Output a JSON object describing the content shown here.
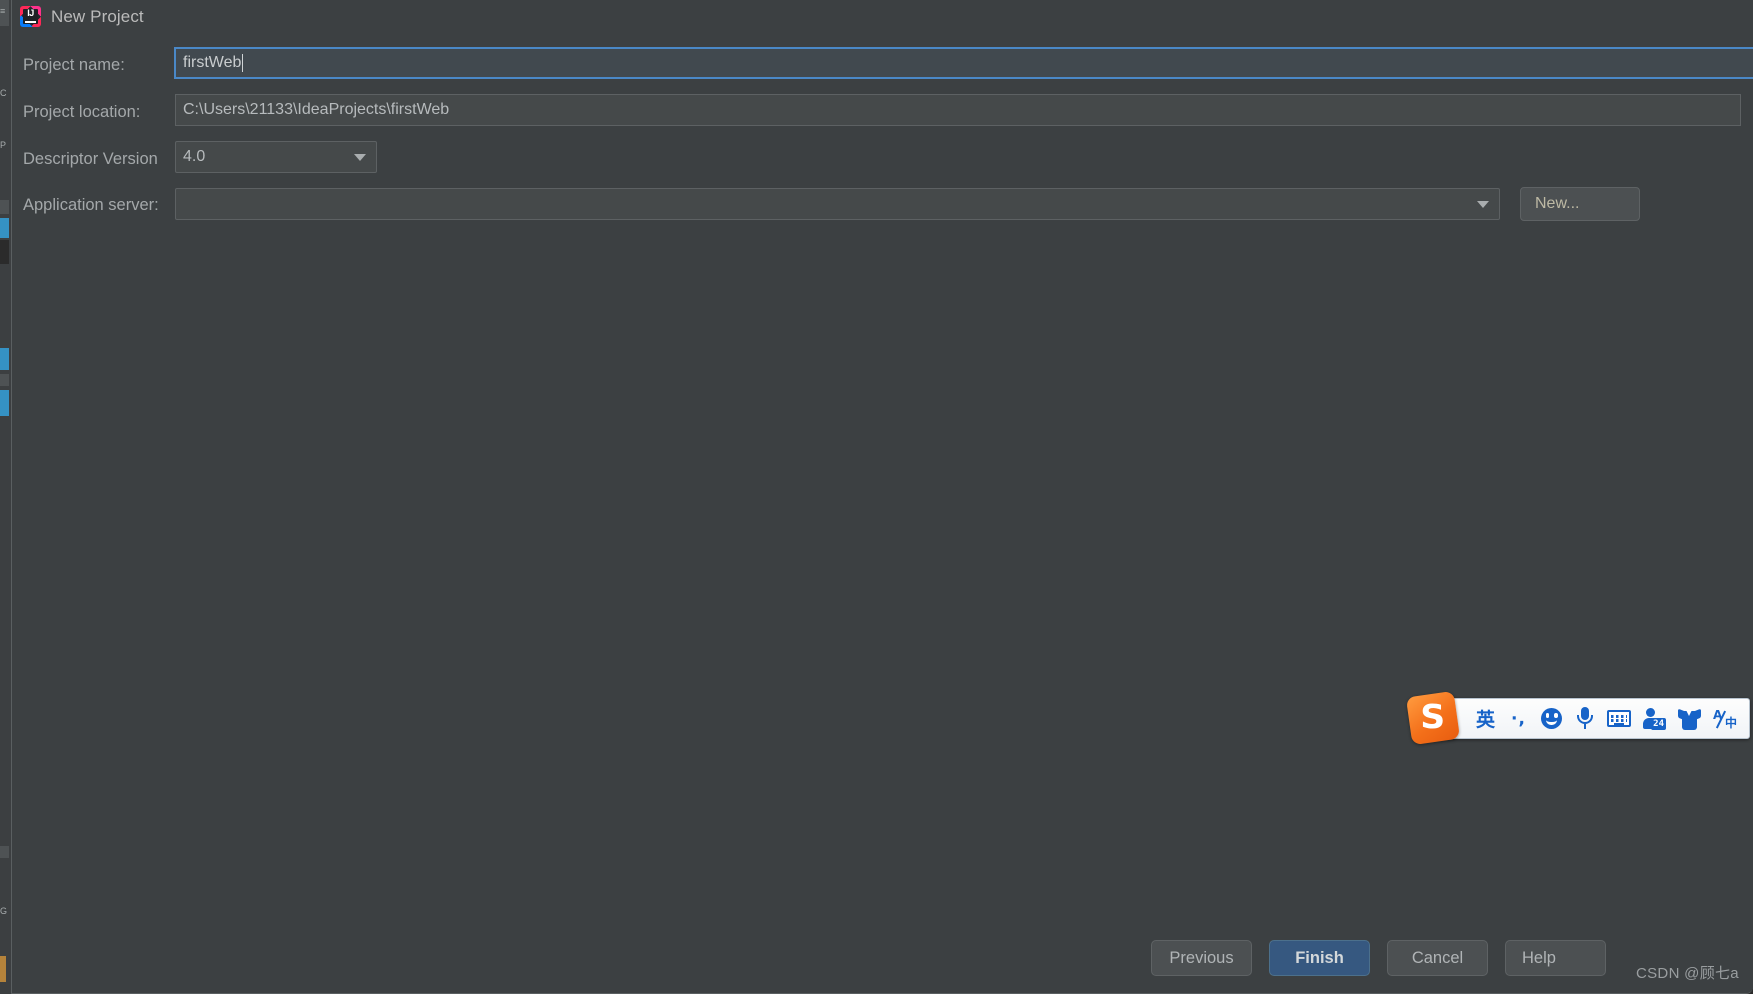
{
  "window": {
    "title": "New Project",
    "app_icon": "intellij-idea-logo-icon"
  },
  "form": {
    "project_name": {
      "label": "Project name:",
      "value": "firstWeb",
      "focused": true
    },
    "project_location": {
      "label": "Project location:",
      "value": "C:\\Users\\21133\\IdeaProjects\\firstWeb"
    },
    "descriptor_version": {
      "label": "Descriptor Version",
      "value": "4.0",
      "icon": "chevron-down-icon"
    },
    "application_server": {
      "label": "Application server:",
      "value": "",
      "icon": "chevron-down-icon",
      "new_button_label": "New..."
    }
  },
  "buttons": {
    "previous": "Previous",
    "finish": "Finish",
    "cancel": "Cancel",
    "help": "Help",
    "finish_accent_color": "#365880"
  },
  "ime": {
    "name": "sogou-input-method-toolbar",
    "logo_glyph": "S",
    "logo_color": "#f4701a",
    "accent_color": "#1763c8",
    "items": [
      {
        "id": "language-mode",
        "label": "英",
        "icon": "language-mode-icon"
      },
      {
        "id": "punctuation-mode",
        "label": "·,",
        "icon": "punctuation-icon"
      },
      {
        "id": "emoji",
        "label": "",
        "icon": "emoji-face-icon"
      },
      {
        "id": "voice-input",
        "label": "",
        "icon": "microphone-icon"
      },
      {
        "id": "soft-keyboard",
        "label": "",
        "icon": "keyboard-icon"
      },
      {
        "id": "user-center",
        "label": "24",
        "icon": "user-badge-icon"
      },
      {
        "id": "skin",
        "label": "",
        "icon": "shirt-icon"
      },
      {
        "id": "translate",
        "label": "A/中",
        "icon": "translate-icon"
      }
    ]
  },
  "watermark": {
    "text": "CSDN @顾七a"
  },
  "theme": {
    "dialog_background": "#3c4042",
    "field_background": "#45494a",
    "field_border": "#5d6163",
    "focus_border": "#4a88c7",
    "label_text": "#a4a8aa",
    "value_text": "#b7bbbd"
  }
}
